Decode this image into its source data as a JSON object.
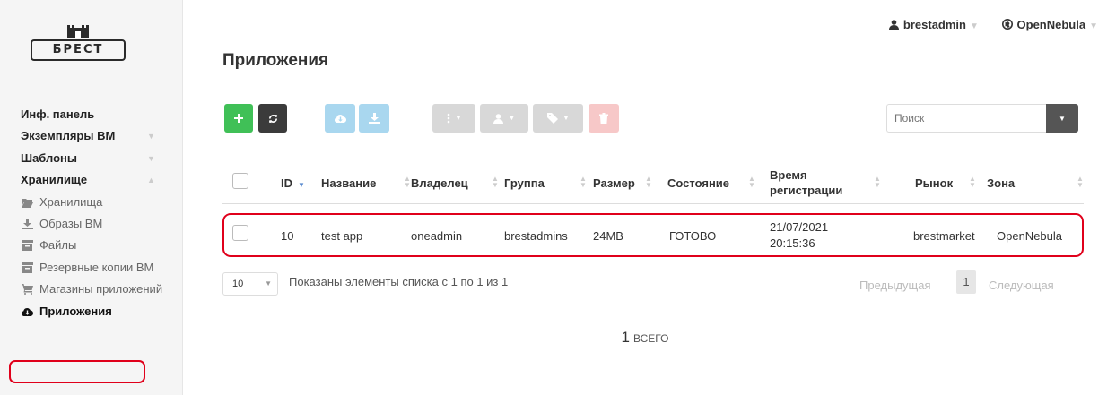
{
  "logo": {
    "text": "БРЕСТ"
  },
  "sidebar": {
    "items": [
      {
        "label": "Инф. панель"
      },
      {
        "label": "Экземпляры ВМ",
        "chevron": "▼"
      },
      {
        "label": "Шаблоны",
        "chevron": "▼"
      },
      {
        "label": "Хранилище",
        "chevron": "▲"
      }
    ],
    "subitems": [
      {
        "label": "Хранилища",
        "icon": "folder-open-icon"
      },
      {
        "label": "Образы ВМ",
        "icon": "download-icon"
      },
      {
        "label": "Файлы",
        "icon": "archive-icon"
      },
      {
        "label": "Резервные копии ВМ",
        "icon": "archive-icon"
      },
      {
        "label": "Магазины приложений",
        "icon": "cart-icon"
      },
      {
        "label": "Приложения",
        "icon": "cloud-download-icon",
        "active": true
      }
    ]
  },
  "topbar": {
    "user": "brestadmin",
    "zone": "OpenNebula",
    "caret": "▼"
  },
  "page": {
    "title": "Приложения"
  },
  "toolbar": {
    "colors": {
      "create": "#40c057",
      "refresh": "#3b3b3b",
      "export": "#a9d7ef",
      "action": "#d8d8d8",
      "delete": "#f7c8c8"
    },
    "search_placeholder": "Поиск"
  },
  "table": {
    "columns": [
      "ID",
      "Название",
      "Владелец",
      "Группа",
      "Размер",
      "Состояние",
      "Время регистрации",
      "Рынок",
      "Зона"
    ],
    "time_header": {
      "line1": "Время",
      "line2": "регистрации"
    },
    "rows": [
      {
        "id": "10",
        "name": "test app",
        "owner": "oneadmin",
        "group": "brestadmins",
        "size": "24MB",
        "state": "ГОТОВО",
        "date": "21/07/2021",
        "time": "20:15:36",
        "market": "brestmarket",
        "zone": "OpenNebula"
      }
    ]
  },
  "footer": {
    "page_size": "10",
    "info": "Показаны элементы списка с 1 по 1 из 1",
    "prev": "Предыдущая",
    "page": "1",
    "next": "Следующая",
    "total_count": "1",
    "total_label": "ВСЕГО"
  }
}
